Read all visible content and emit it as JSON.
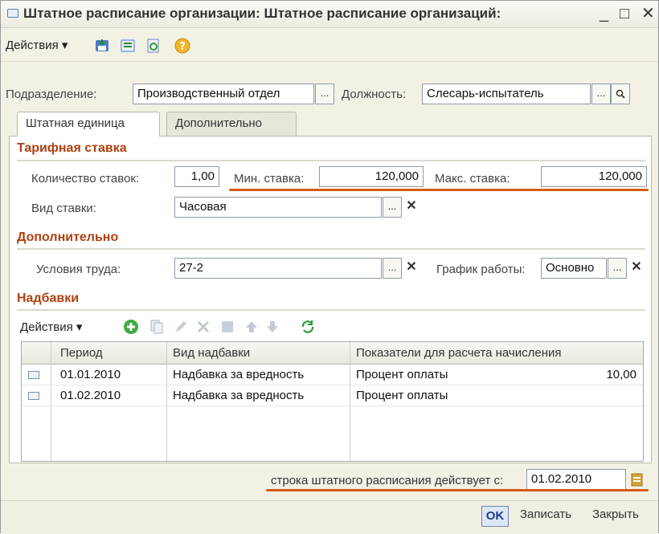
{
  "window": {
    "title": "Штатное расписание организации: Штатное расписание организаций:",
    "minimize": "_",
    "maximize": "□",
    "close": "✕"
  },
  "toolbar": {
    "actions_label": "Действия ▾",
    "icons": [
      "save-icon",
      "list-icon",
      "refresh-icon",
      "help-icon"
    ]
  },
  "header": {
    "department_label": "Подразделение:",
    "department_value": "Производственный отдел",
    "position_label": "Должность:",
    "position_value": "Слесарь-испытатель"
  },
  "tabs": [
    {
      "label": "Штатная единица",
      "active": true
    },
    {
      "label": "Дополнительно",
      "active": false
    }
  ],
  "tariff": {
    "section_title": "Тарифная ставка",
    "count_label": "Количество ставок:",
    "count_value": "1,00",
    "min_label": "Мин. ставка:",
    "min_value": "120,000",
    "max_label": "Макс. ставка:",
    "max_value": "120,000",
    "kind_label": "Вид ставки:",
    "kind_value": "Часовая"
  },
  "additional": {
    "section_title": "Дополнительно",
    "conditions_label": "Условия труда:",
    "conditions_value": "27-2",
    "schedule_label": "График работы:",
    "schedule_value": "Основно"
  },
  "allowances": {
    "section_title": "Надбавки",
    "actions_label": "Действия ▾",
    "columns": [
      "Период",
      "Вид надбавки",
      "Показатели для расчета начисления"
    ],
    "rows": [
      {
        "period": "01.01.2010",
        "kind": "Надбавка за вредность",
        "indicator": "Процент оплаты",
        "value": "10,00"
      },
      {
        "period": "01.02.2010",
        "kind": "Надбавка за вредность",
        "indicator": "Процент оплаты",
        "value": ""
      }
    ]
  },
  "valid_from": {
    "label": "строка штатного расписания действует с:",
    "value": "01.02.2010"
  },
  "footer": {
    "ok": "OK",
    "save": "Записать",
    "close": "Закрыть"
  },
  "colors": {
    "accent_underline": "#d45a13",
    "section_title": "#b04010",
    "window_bg": "#f3f1e4"
  }
}
